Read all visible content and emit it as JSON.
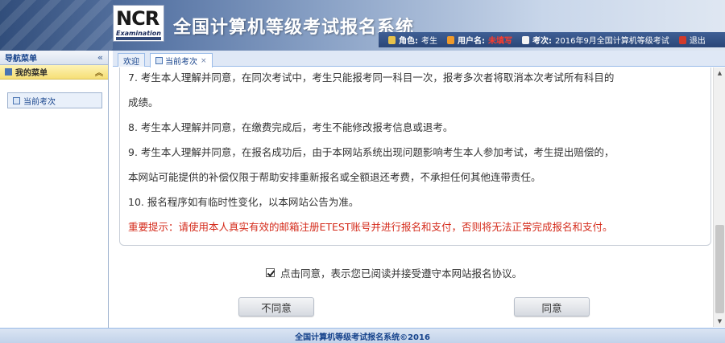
{
  "header": {
    "logo_text": "NCR",
    "logo_sub": "Examination",
    "site_title": "全国计算机等级考试报名系统",
    "role_label": "角色:",
    "role_value": "考生",
    "user_label": "用户名:",
    "user_value": "未填写",
    "exam_label": "考次:",
    "exam_value": "2016年9月全国计算机等级考试",
    "exit_label": "退出"
  },
  "sidebar": {
    "title": "导航菜单",
    "collapse_glyph": "«",
    "menu_title": "我的菜单",
    "menu_toggle_glyph": "︽",
    "items": [
      {
        "label": "当前考次"
      }
    ]
  },
  "tabs": [
    {
      "label": "欢迎"
    },
    {
      "label": "当前考次",
      "close": "×"
    }
  ],
  "agreement": {
    "lines": [
      "7. 考生本人理解并同意，在同次考试中，考生只能报考同一科目一次，报考多次者将取消本次考试所有科目的",
      "成绩。",
      "8. 考生本人理解并同意，在缴费完成后，考生不能修改报考信息或退考。",
      "9. 考生本人理解并同意，在报名成功后，由于本网站系统出现问题影响考生本人参加考试，考生提出赔偿的，",
      "本网站可能提供的补偿仅限于帮助安排重新报名或全额退还考费，不承担任何其他连带责任。",
      "10. 报名程序如有临时性变化，以本网站公告为准。"
    ],
    "warning": "重要提示：请使用本人真实有效的邮箱注册ETEST账号并进行报名和支付，否则将无法正常完成报名和支付。"
  },
  "consent": {
    "checked": true,
    "label": "点击同意，表示您已阅读并接受遵守本网站报名协议。"
  },
  "buttons": {
    "disagree": "不同意",
    "agree": "同意"
  },
  "scrollbar": {
    "up_glyph": "▲",
    "down_glyph": "▼"
  },
  "footer": {
    "text": "全国计算机等级考试报名系统©2016"
  },
  "colors": {
    "header_bar": "#2a4677",
    "username": "#ff3b2a",
    "warning_text": "#d42a1a",
    "tab_border": "#99bbe8"
  }
}
